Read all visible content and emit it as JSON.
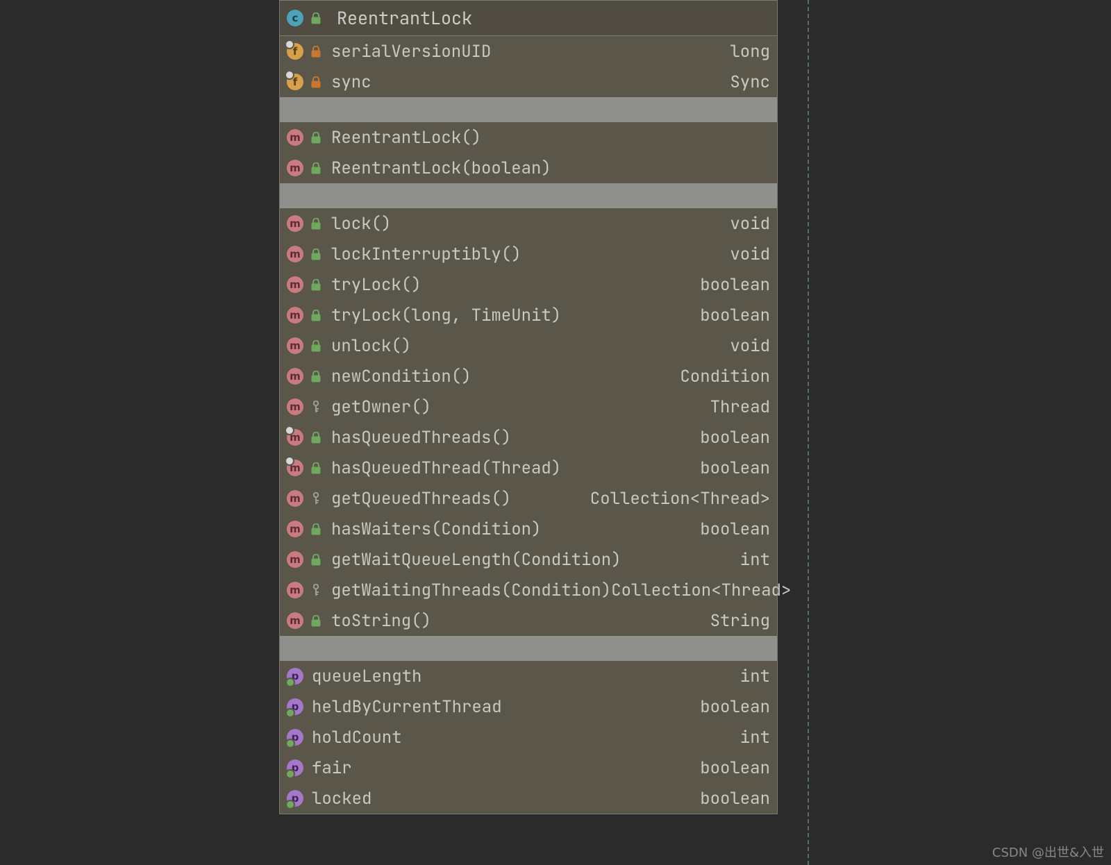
{
  "header": {
    "name": "ReentrantLock"
  },
  "fields": [
    {
      "name": "serialVersionUID",
      "type": "long",
      "badge": "f",
      "vis": "lock-orange",
      "overlay": "white"
    },
    {
      "name": "sync",
      "type": "Sync",
      "badge": "f",
      "vis": "lock-orange",
      "overlay": "white"
    }
  ],
  "constructors": [
    {
      "name": "ReentrantLock()",
      "badge": "m",
      "vis": "lock-green"
    },
    {
      "name": "ReentrantLock(boolean)",
      "badge": "m",
      "vis": "lock-green"
    }
  ],
  "methods": [
    {
      "name": "lock()",
      "type": "void",
      "badge": "m",
      "vis": "lock-green"
    },
    {
      "name": "lockInterruptibly()",
      "type": "void",
      "badge": "m",
      "vis": "lock-green"
    },
    {
      "name": "tryLock()",
      "type": "boolean",
      "badge": "m",
      "vis": "lock-green"
    },
    {
      "name": "tryLock(long, TimeUnit)",
      "type": "boolean",
      "badge": "m",
      "vis": "lock-green"
    },
    {
      "name": "unlock()",
      "type": "void",
      "badge": "m",
      "vis": "lock-green"
    },
    {
      "name": "newCondition()",
      "type": "Condition",
      "badge": "m",
      "vis": "lock-green"
    },
    {
      "name": "getOwner()",
      "type": "Thread",
      "badge": "m",
      "vis": "key"
    },
    {
      "name": "hasQueuedThreads()",
      "type": "boolean",
      "badge": "m",
      "vis": "lock-green",
      "overlay": "white"
    },
    {
      "name": "hasQueuedThread(Thread)",
      "type": "boolean",
      "badge": "m",
      "vis": "lock-green",
      "overlay": "white"
    },
    {
      "name": "getQueuedThreads()",
      "type": "Collection<Thread>",
      "badge": "m",
      "vis": "key"
    },
    {
      "name": "hasWaiters(Condition)",
      "type": "boolean",
      "badge": "m",
      "vis": "lock-green"
    },
    {
      "name": "getWaitQueueLength(Condition)",
      "type": "int",
      "badge": "m",
      "vis": "lock-green"
    },
    {
      "name": "getWaitingThreads(Condition)",
      "type": "Collection<Thread>",
      "badge": "m",
      "vis": "key"
    },
    {
      "name": "toString()",
      "type": "String",
      "badge": "m",
      "vis": "lock-green"
    }
  ],
  "properties": [
    {
      "name": "queueLength",
      "type": "int",
      "badge": "p",
      "overlay": "green"
    },
    {
      "name": "heldByCurrentThread",
      "type": "boolean",
      "badge": "p",
      "overlay": "green"
    },
    {
      "name": "holdCount",
      "type": "int",
      "badge": "p",
      "overlay": "green"
    },
    {
      "name": "fair",
      "type": "boolean",
      "badge": "p",
      "overlay": "green"
    },
    {
      "name": "locked",
      "type": "boolean",
      "badge": "p",
      "overlay": "green"
    }
  ],
  "watermark": "CSDN @出世&入世"
}
